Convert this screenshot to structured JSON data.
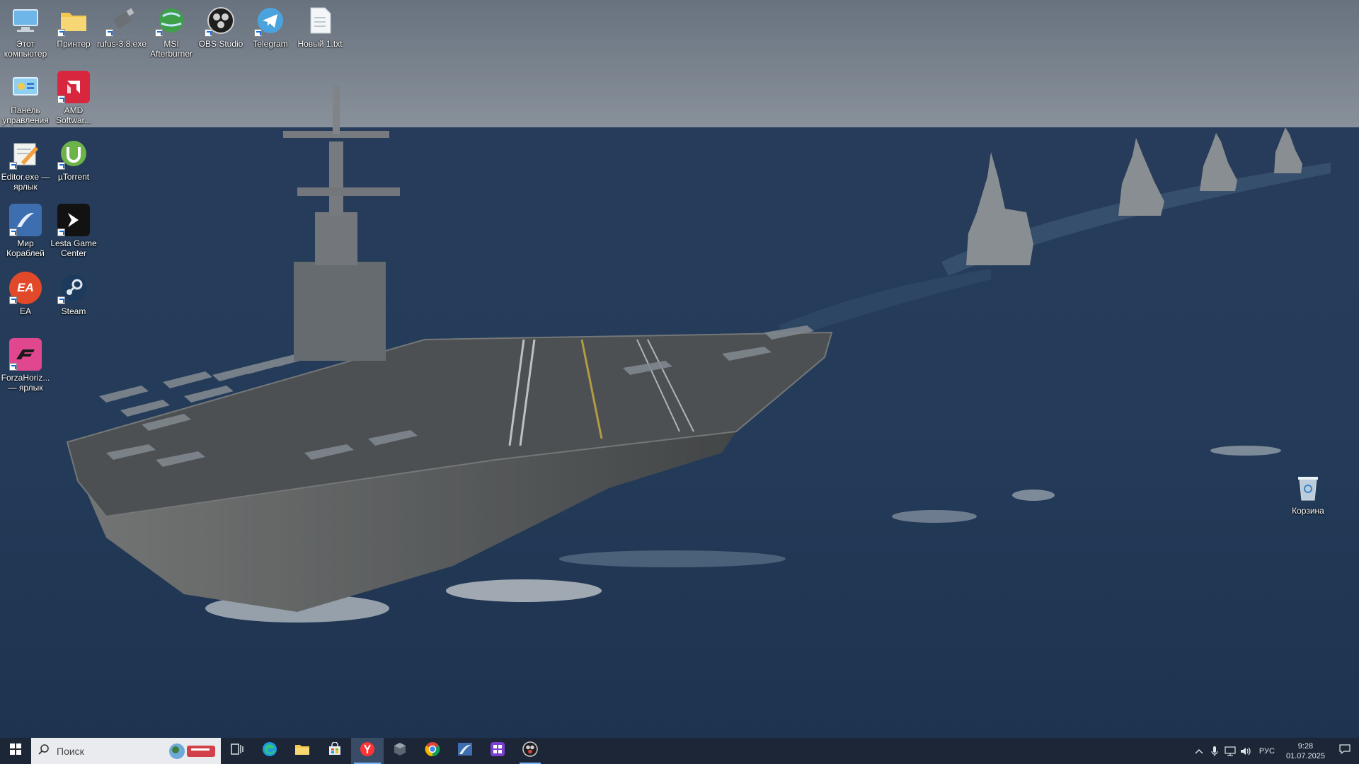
{
  "desktop": {
    "icons": [
      {
        "name": "this-pc-icon",
        "label": "Этот компьютер"
      },
      {
        "name": "printer-folder-icon",
        "label": "Принтер"
      },
      {
        "name": "rufus-icon",
        "label": "rufus-3.8.exe"
      },
      {
        "name": "msi-afterburner-icon",
        "label": "MSI Afterburner"
      },
      {
        "name": "obs-studio-icon",
        "label": "OBS Studio"
      },
      {
        "name": "telegram-icon",
        "label": "Telegram"
      },
      {
        "name": "new-text-file-icon",
        "label": "Новый 1.txt"
      },
      {
        "name": "control-panel-icon",
        "label": "Панель управления"
      },
      {
        "name": "amd-software-icon",
        "label": "AMD Softwar..."
      },
      {
        "name": "editor-shortcut-icon",
        "label": "Editor.exe — ярлык"
      },
      {
        "name": "utorrent-icon",
        "label": "µTorrent"
      },
      {
        "name": "mir-korabley-icon",
        "label": "Мир Кораблей"
      },
      {
        "name": "lesta-game-center-icon",
        "label": "Lesta Game Center"
      },
      {
        "name": "ea-icon",
        "label": "EA"
      },
      {
        "name": "steam-icon",
        "label": "Steam"
      },
      {
        "name": "forza-horizon-icon",
        "label": "ForzaHoriz... — ярлык"
      },
      {
        "name": "recycle-bin-icon",
        "label": "Корзина"
      }
    ]
  },
  "taskbar": {
    "search_placeholder": "Поиск",
    "pinned": [
      "task-view-icon",
      "edge-icon",
      "file-explorer-icon",
      "store-icon",
      "yandex-browser-icon",
      "app-cube-icon",
      "chrome-icon",
      "mir-korabley-taskbar-icon",
      "app-grid-icon",
      "obs-taskbar-icon"
    ],
    "tray": {
      "language": "РУС",
      "time": "9:28",
      "date": "01.07.2025"
    }
  },
  "colors": {
    "taskbar_bg": "#1d2636",
    "accent": "#7fb6ff"
  }
}
